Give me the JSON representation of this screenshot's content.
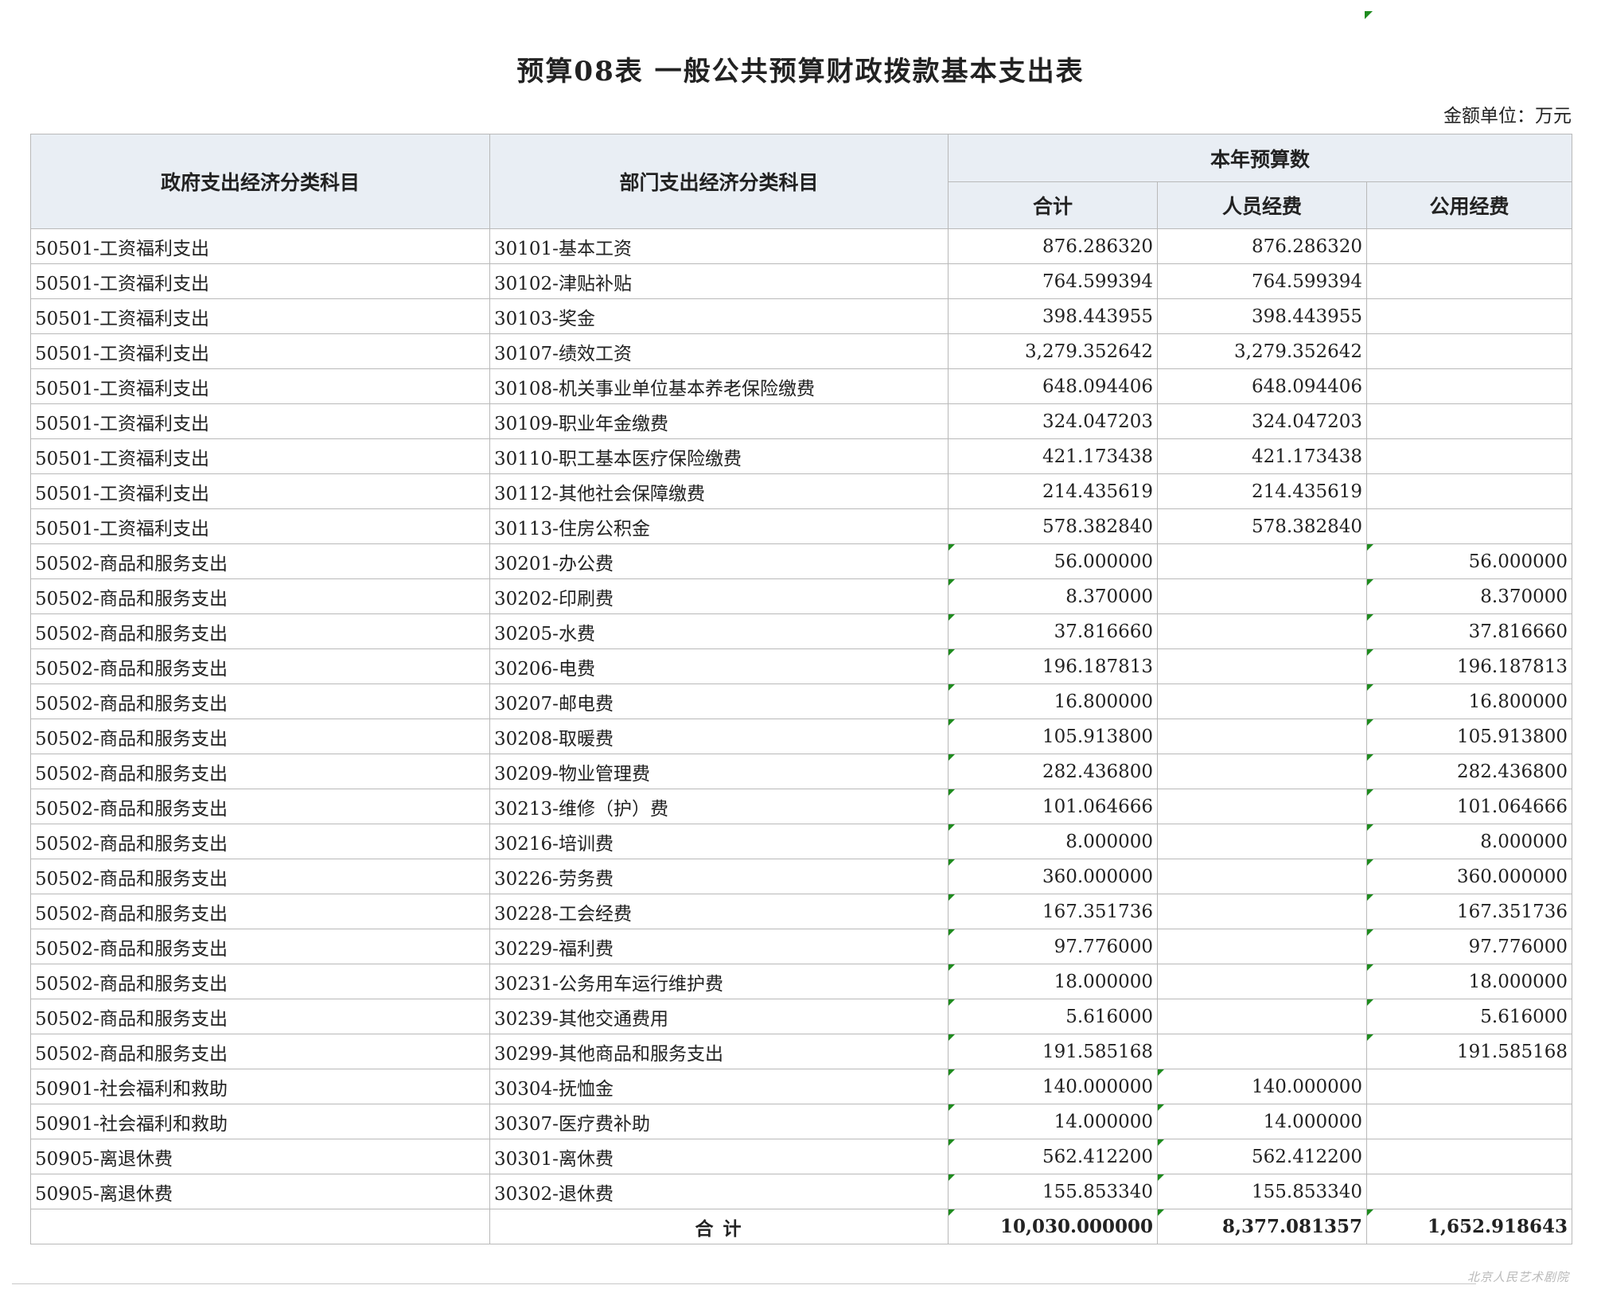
{
  "title": "预算08表  一般公共预算财政拨款基本支出表",
  "unit": "金额单位：万元",
  "headers": {
    "gov": "政府支出经济分类科目",
    "dept": "部门支出经济分类科目",
    "year": "本年预算数",
    "total": "合计",
    "personnel": "人员经费",
    "public": "公用经费"
  },
  "rows": [
    {
      "gov": "50501-工资福利支出",
      "dept": "30101-基本工资",
      "total": "876.286320",
      "personnel": "876.286320",
      "public": ""
    },
    {
      "gov": "50501-工资福利支出",
      "dept": "30102-津贴补贴",
      "total": "764.599394",
      "personnel": "764.599394",
      "public": ""
    },
    {
      "gov": "50501-工资福利支出",
      "dept": "30103-奖金",
      "total": "398.443955",
      "personnel": "398.443955",
      "public": ""
    },
    {
      "gov": "50501-工资福利支出",
      "dept": "30107-绩效工资",
      "total": "3,279.352642",
      "personnel": "3,279.352642",
      "public": ""
    },
    {
      "gov": "50501-工资福利支出",
      "dept": "30108-机关事业单位基本养老保险缴费",
      "total": "648.094406",
      "personnel": "648.094406",
      "public": ""
    },
    {
      "gov": "50501-工资福利支出",
      "dept": "30109-职业年金缴费",
      "total": "324.047203",
      "personnel": "324.047203",
      "public": ""
    },
    {
      "gov": "50501-工资福利支出",
      "dept": "30110-职工基本医疗保险缴费",
      "total": "421.173438",
      "personnel": "421.173438",
      "public": ""
    },
    {
      "gov": "50501-工资福利支出",
      "dept": "30112-其他社会保障缴费",
      "total": "214.435619",
      "personnel": "214.435619",
      "public": ""
    },
    {
      "gov": "50501-工资福利支出",
      "dept": "30113-住房公积金",
      "total": "578.382840",
      "personnel": "578.382840",
      "public": ""
    },
    {
      "gov": "50502-商品和服务支出",
      "dept": "30201-办公费",
      "total": "56.000000",
      "personnel": "",
      "public": "56.000000"
    },
    {
      "gov": "50502-商品和服务支出",
      "dept": "30202-印刷费",
      "total": "8.370000",
      "personnel": "",
      "public": "8.370000"
    },
    {
      "gov": "50502-商品和服务支出",
      "dept": "30205-水费",
      "total": "37.816660",
      "personnel": "",
      "public": "37.816660"
    },
    {
      "gov": "50502-商品和服务支出",
      "dept": "30206-电费",
      "total": "196.187813",
      "personnel": "",
      "public": "196.187813"
    },
    {
      "gov": "50502-商品和服务支出",
      "dept": "30207-邮电费",
      "total": "16.800000",
      "personnel": "",
      "public": "16.800000"
    },
    {
      "gov": "50502-商品和服务支出",
      "dept": "30208-取暖费",
      "total": "105.913800",
      "personnel": "",
      "public": "105.913800"
    },
    {
      "gov": "50502-商品和服务支出",
      "dept": "30209-物业管理费",
      "total": "282.436800",
      "personnel": "",
      "public": "282.436800"
    },
    {
      "gov": "50502-商品和服务支出",
      "dept": "30213-维修（护）费",
      "total": "101.064666",
      "personnel": "",
      "public": "101.064666"
    },
    {
      "gov": "50502-商品和服务支出",
      "dept": "30216-培训费",
      "total": "8.000000",
      "personnel": "",
      "public": "8.000000"
    },
    {
      "gov": "50502-商品和服务支出",
      "dept": "30226-劳务费",
      "total": "360.000000",
      "personnel": "",
      "public": "360.000000"
    },
    {
      "gov": "50502-商品和服务支出",
      "dept": "30228-工会经费",
      "total": "167.351736",
      "personnel": "",
      "public": "167.351736"
    },
    {
      "gov": "50502-商品和服务支出",
      "dept": "30229-福利费",
      "total": "97.776000",
      "personnel": "",
      "public": "97.776000"
    },
    {
      "gov": "50502-商品和服务支出",
      "dept": "30231-公务用车运行维护费",
      "total": "18.000000",
      "personnel": "",
      "public": "18.000000"
    },
    {
      "gov": "50502-商品和服务支出",
      "dept": "30239-其他交通费用",
      "total": "5.616000",
      "personnel": "",
      "public": "5.616000"
    },
    {
      "gov": "50502-商品和服务支出",
      "dept": "30299-其他商品和服务支出",
      "total": "191.585168",
      "personnel": "",
      "public": "191.585168"
    },
    {
      "gov": "50901-社会福利和救助",
      "dept": "30304-抚恤金",
      "total": "140.000000",
      "personnel": "140.000000",
      "public": ""
    },
    {
      "gov": "50901-社会福利和救助",
      "dept": "30307-医疗费补助",
      "total": "14.000000",
      "personnel": "14.000000",
      "public": ""
    },
    {
      "gov": "50905-离退休费",
      "dept": "30301-离休费",
      "total": "562.412200",
      "personnel": "562.412200",
      "public": ""
    },
    {
      "gov": "50905-离退休费",
      "dept": "30302-退休费",
      "total": "155.853340",
      "personnel": "155.853340",
      "public": ""
    }
  ],
  "totals": {
    "label": "合      计",
    "total": "10,030.000000",
    "personnel": "8,377.081357",
    "public": "1,652.918643"
  },
  "seal_text": "北京人民艺术剧院"
}
